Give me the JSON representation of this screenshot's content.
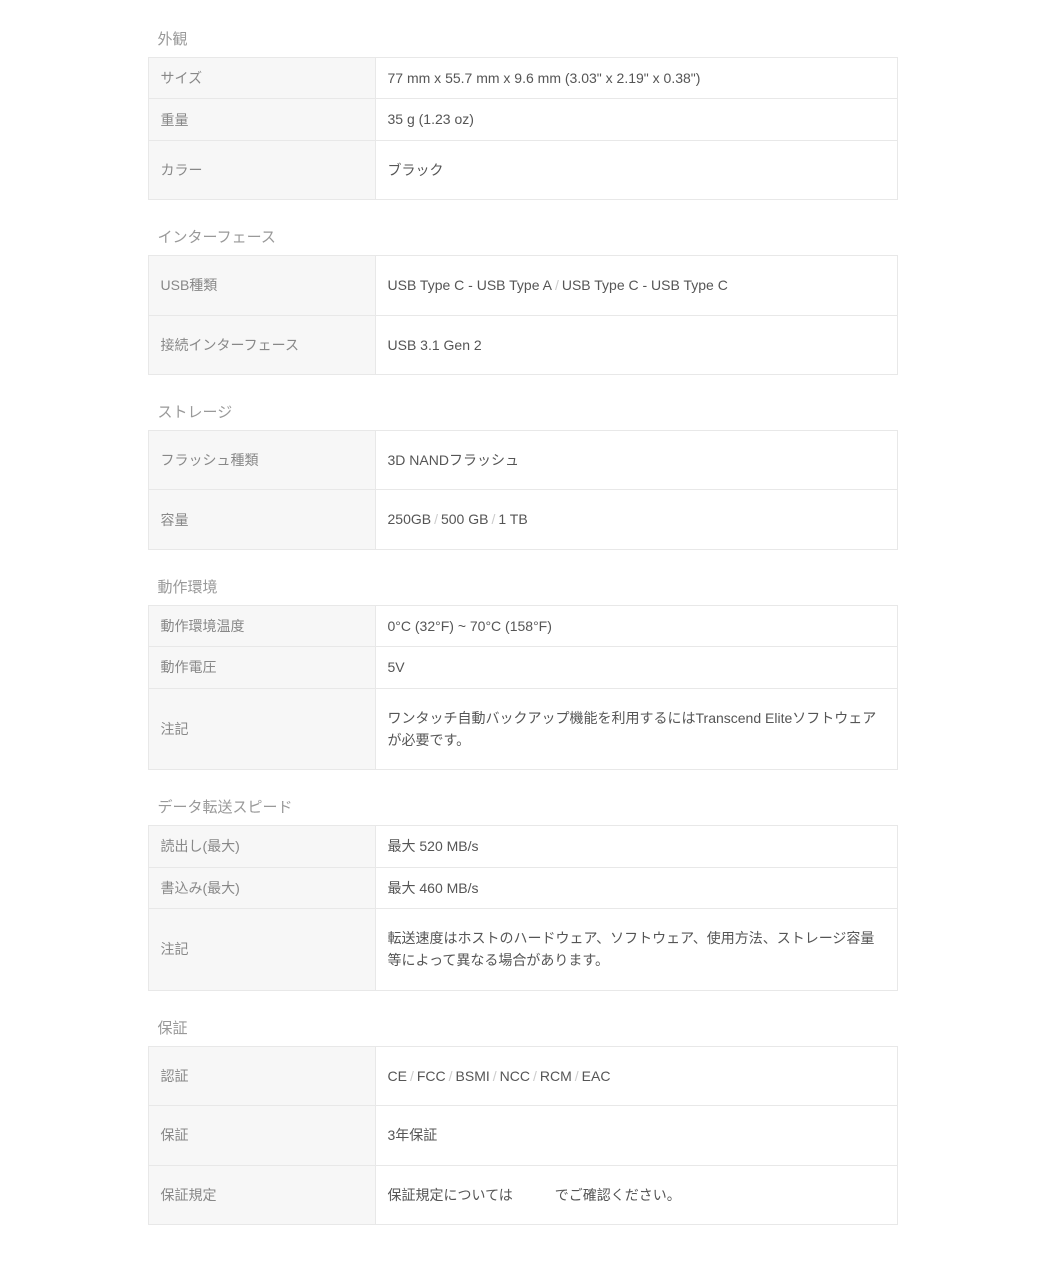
{
  "sections": [
    {
      "title": "外観",
      "rows": [
        {
          "label": "サイズ",
          "value": "77 mm x 55.7 mm x 9.6 mm (3.03\" x 2.19\" x 0.38\")"
        },
        {
          "label": "重量",
          "value": "35 g (1.23 oz)"
        },
        {
          "label": "カラー",
          "value": "ブラック",
          "tall": true
        }
      ]
    },
    {
      "title": "インターフェース",
      "rows": [
        {
          "label": "USB種類",
          "values": [
            "USB Type C - USB Type A",
            "USB Type C - USB Type C"
          ],
          "tall": true
        },
        {
          "label": "接続インターフェース",
          "value": "USB 3.1 Gen 2",
          "tall": true
        }
      ]
    },
    {
      "title": "ストレージ",
      "rows": [
        {
          "label": "フラッシュ種類",
          "value": "3D NANDフラッシュ",
          "tall": true
        },
        {
          "label": "容量",
          "values": [
            "250GB",
            "500 GB",
            "1 TB"
          ],
          "tall": true
        }
      ]
    },
    {
      "title": "動作環境",
      "rows": [
        {
          "label": "動作環境温度",
          "value": "0°C (32°F) ~ 70°C (158°F)"
        },
        {
          "label": "動作電圧",
          "value": "5V"
        },
        {
          "label": "注記",
          "value": "ワンタッチ自動バックアップ機能を利用するにはTranscend Eliteソフトウェアが必要です。",
          "tall": true
        }
      ]
    },
    {
      "title": "データ転送スピード",
      "rows": [
        {
          "label": "読出し(最大)",
          "value": "最大 520 MB/s"
        },
        {
          "label": "書込み(最大)",
          "value": "最大 460 MB/s"
        },
        {
          "label": "注記",
          "value": "転送速度はホストのハードウェア、ソフトウェア、使用方法、ストレージ容量等によって異なる場合があります。",
          "tall": true
        }
      ]
    },
    {
      "title": "保証",
      "rows": [
        {
          "label": "認証",
          "values": [
            "CE",
            "FCC",
            "BSMI",
            "NCC",
            "RCM",
            "EAC"
          ],
          "tall": true
        },
        {
          "label": "保証",
          "value": "3年保証",
          "tall": true
        },
        {
          "label": "保証規定",
          "value": "保証規定については　　　でご確認ください。",
          "tall": true
        }
      ]
    }
  ],
  "separator": "/"
}
